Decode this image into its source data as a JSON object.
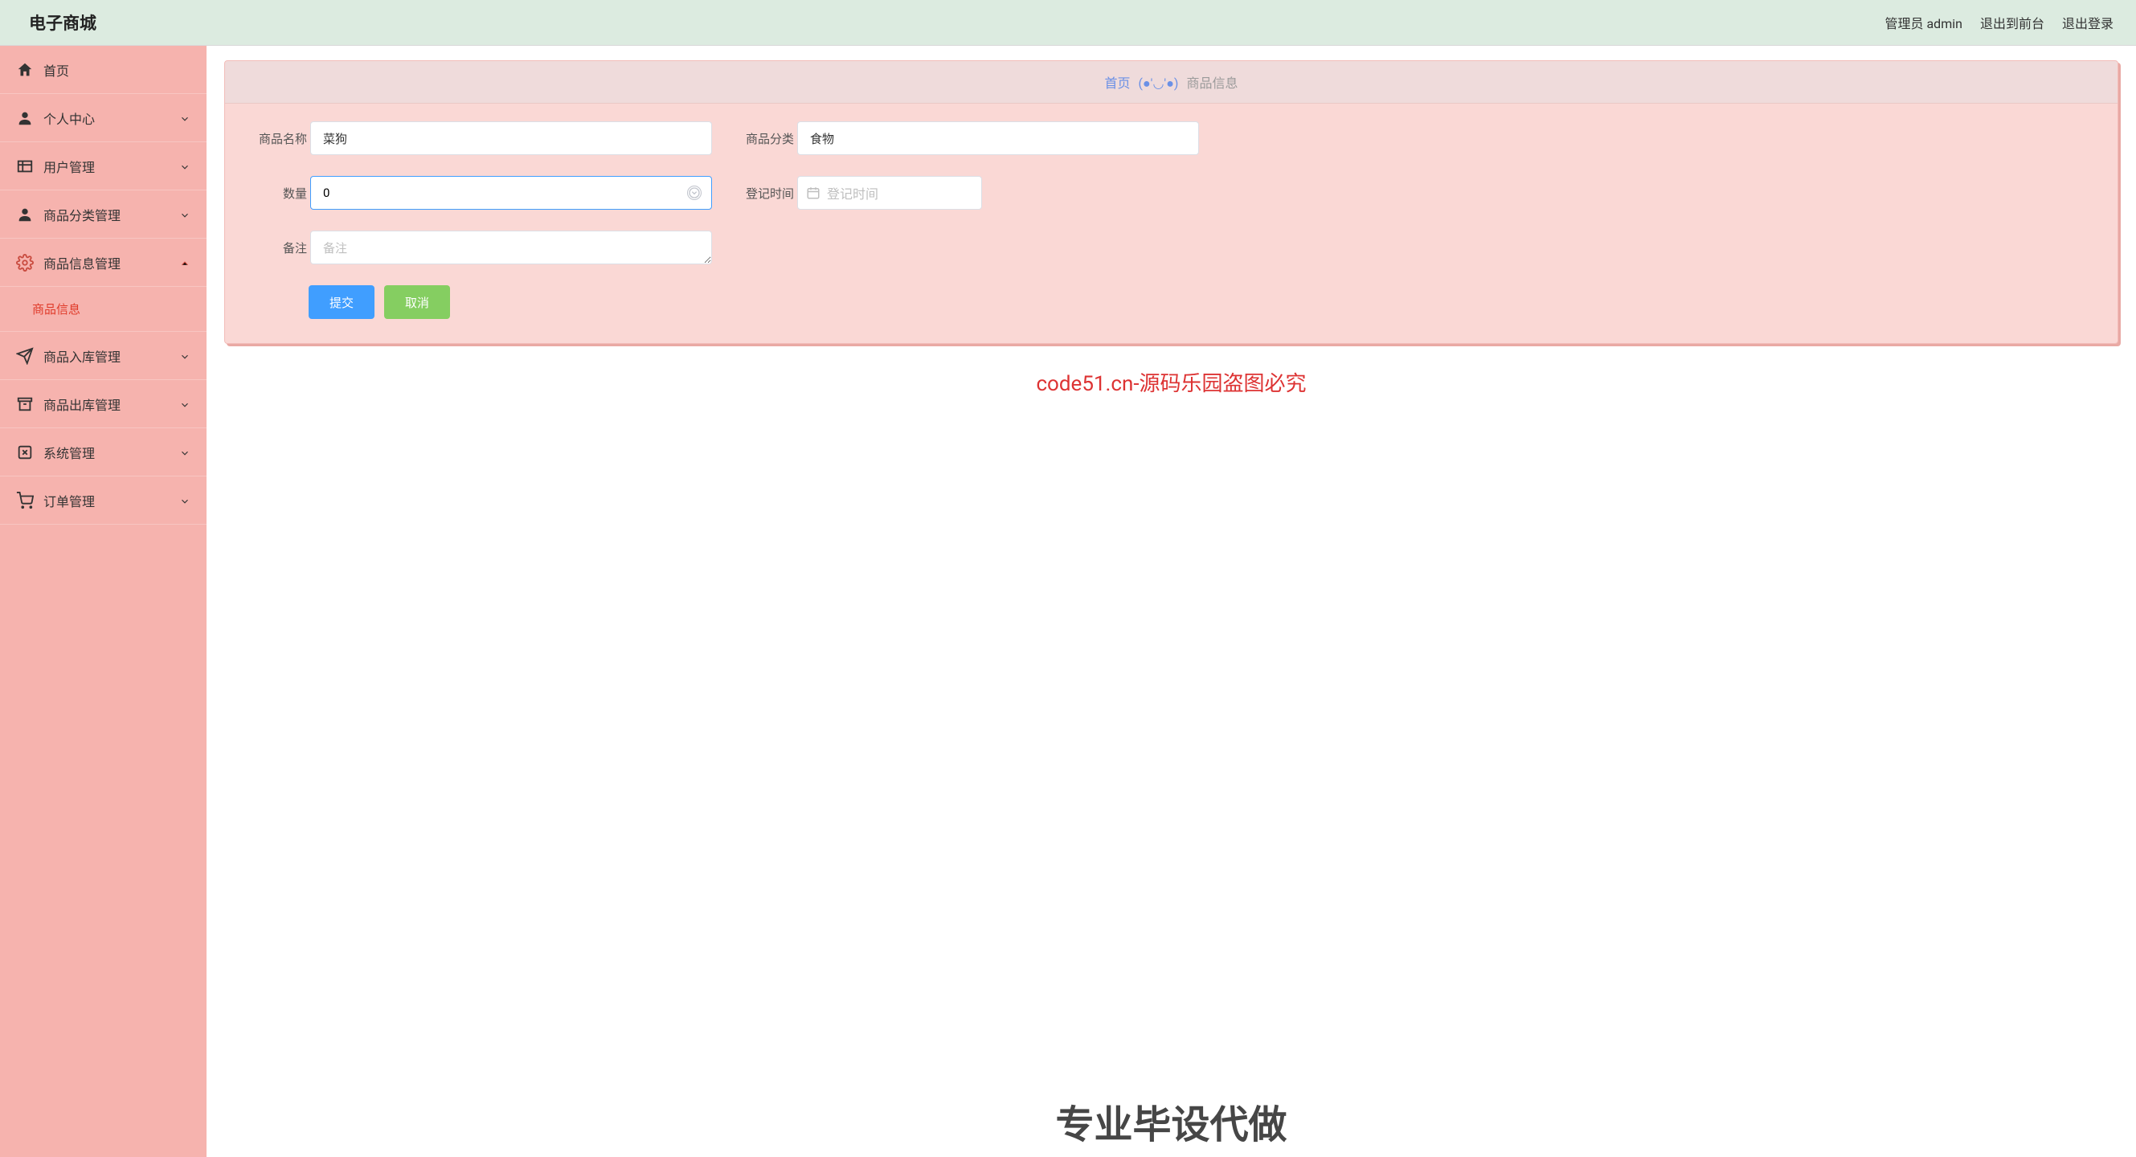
{
  "header": {
    "logo": "电子商城",
    "role_label": "管理员 admin",
    "to_front": "退出到前台",
    "logout": "退出登录"
  },
  "sidebar": {
    "items": [
      {
        "icon": "home",
        "label": "首页",
        "expandable": false
      },
      {
        "icon": "user",
        "label": "个人中心",
        "expandable": true,
        "open": false
      },
      {
        "icon": "grid",
        "label": "用户管理",
        "expandable": true,
        "open": false
      },
      {
        "icon": "user",
        "label": "商品分类管理",
        "expandable": true,
        "open": false
      },
      {
        "icon": "gear",
        "label": "商品信息管理",
        "expandable": true,
        "open": true,
        "children": [
          "商品信息"
        ]
      },
      {
        "icon": "send",
        "label": "商品入库管理",
        "expandable": true,
        "open": false
      },
      {
        "icon": "archive",
        "label": "商品出库管理",
        "expandable": true,
        "open": false
      },
      {
        "icon": "close-square",
        "label": "系统管理",
        "expandable": true,
        "open": false
      },
      {
        "icon": "cart",
        "label": "订单管理",
        "expandable": true,
        "open": false
      }
    ]
  },
  "breadcrumb": {
    "home": "首页",
    "face": "(●'◡'●)",
    "current": "商品信息"
  },
  "form": {
    "name_label": "商品名称",
    "name_value": "菜狗",
    "category_label": "商品分类",
    "category_value": "食物",
    "qty_label": "数量",
    "qty_value": "0",
    "time_label": "登记时间",
    "time_placeholder": "登记时间",
    "remark_label": "备注",
    "remark_placeholder": "备注",
    "submit": "提交",
    "cancel": "取消"
  },
  "overlay": {
    "red": "code51.cn-源码乐园盗图必究",
    "big": "专业毕设代做"
  }
}
